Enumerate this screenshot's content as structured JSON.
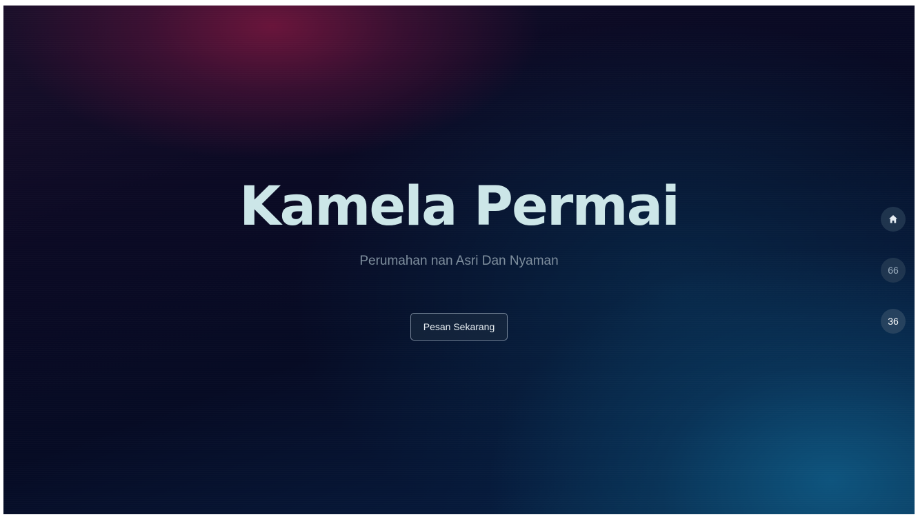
{
  "hero": {
    "title": "Kamela Permai",
    "subtitle": "Perumahan nan Asri Dan Nyaman",
    "cta_label": "Pesan Sekarang"
  },
  "side_nav": {
    "items": [
      {
        "icon": "home-icon",
        "label": ""
      },
      {
        "label": "66"
      },
      {
        "label": "36"
      }
    ],
    "active_index": 2
  },
  "colors": {
    "title": "#cce6e8",
    "subtitle": "#7f8f9e",
    "background_dark": "#060b24",
    "accent_magenta": "#78163e",
    "accent_teal": "#0e5680"
  }
}
